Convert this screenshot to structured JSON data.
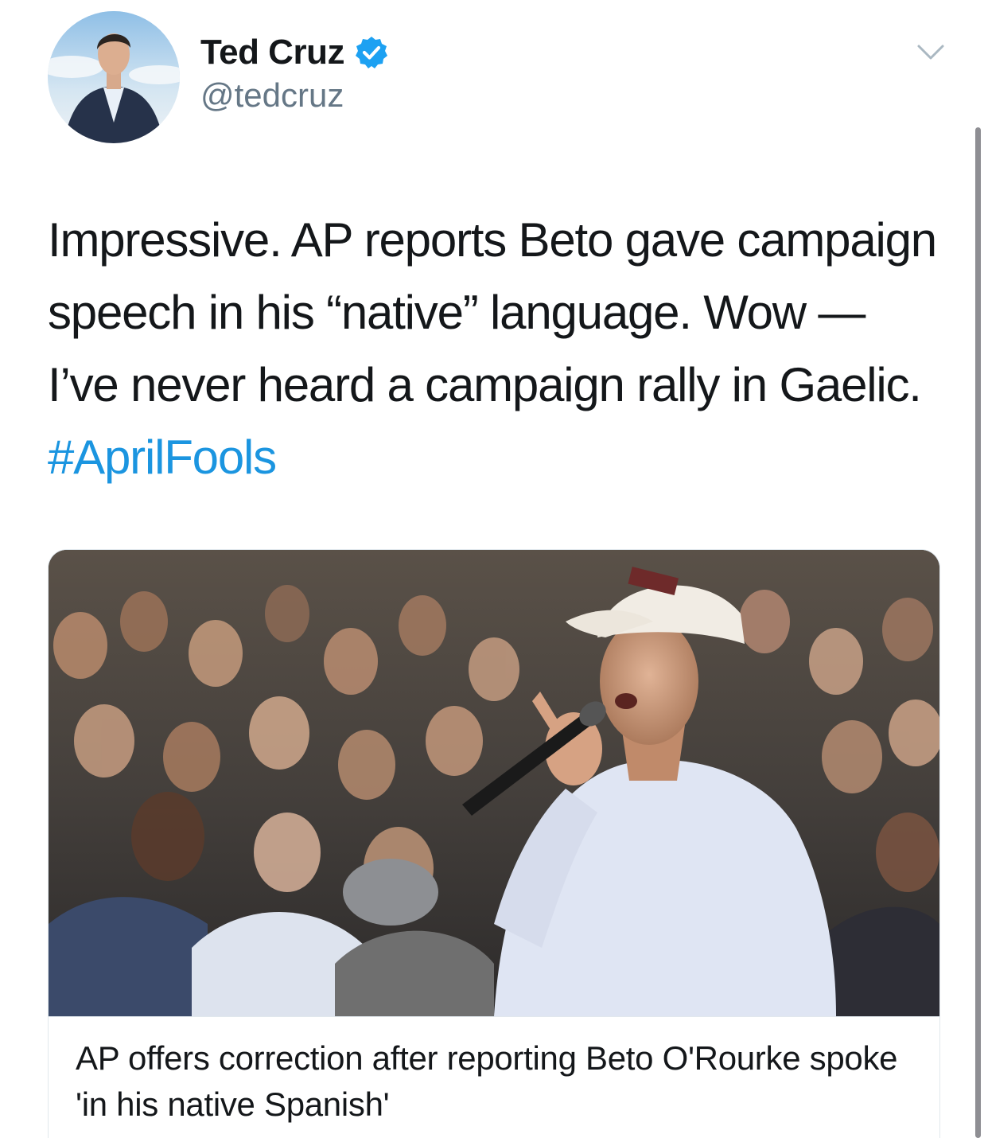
{
  "author": {
    "display_name": "Ted Cruz",
    "handle": "@tedcruz",
    "verified": true,
    "avatar_icon": "profile-photo"
  },
  "tweet": {
    "text_before_hashtag": "Impressive. AP reports Beto gave campaign speech in his “native” language. Wow — I’ve never heard a campaign rally in Gaelic. ",
    "hashtag": "#AprilFools"
  },
  "link_card": {
    "image_icon": "rally-photo",
    "title": "AP offers correction after reporting Beto O'Rourke spoke 'in his native Spanish'"
  },
  "icons": {
    "verified": "verified-badge-icon",
    "more": "chevron-down-icon"
  },
  "colors": {
    "link": "#1b95e0",
    "verified": "#1da1f2",
    "text": "#14171a",
    "secondary_text": "#657786"
  }
}
